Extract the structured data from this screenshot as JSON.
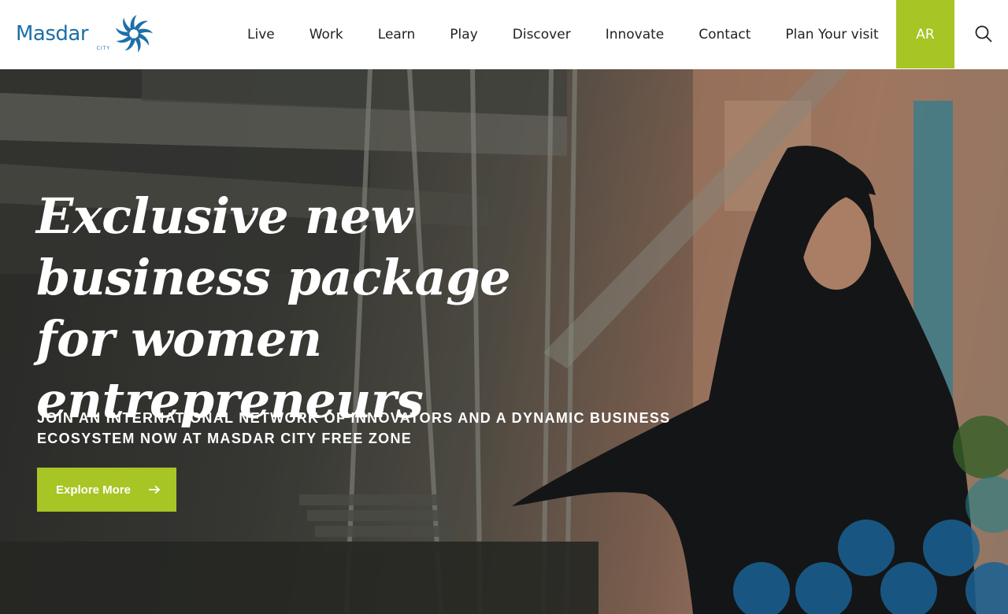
{
  "header": {
    "logo": {
      "word": "Masdar",
      "sub": "CITY"
    },
    "nav": [
      {
        "label": "Live"
      },
      {
        "label": "Work"
      },
      {
        "label": "Learn"
      },
      {
        "label": "Play"
      },
      {
        "label": "Discover"
      },
      {
        "label": "Innovate"
      },
      {
        "label": "Contact"
      },
      {
        "label": "Plan Your visit"
      }
    ],
    "language_button": "AR",
    "search_icon": "search-icon"
  },
  "hero": {
    "title": "Exclusive new business package for women entrepreneurs",
    "subtitle": "JOIN AN INTERNATIONAL NETWORK OF INNOVATORS AND A DYNAMIC BUSINESS ECOSYSTEM NOW AT MASDAR CITY FREE ZONE",
    "cta_label": "Explore More",
    "cta_icon": "arrow-right-icon"
  },
  "colors": {
    "brand_blue": "#1d6fa8",
    "accent_green": "#a7c525",
    "hero_text": "#ffffff"
  }
}
